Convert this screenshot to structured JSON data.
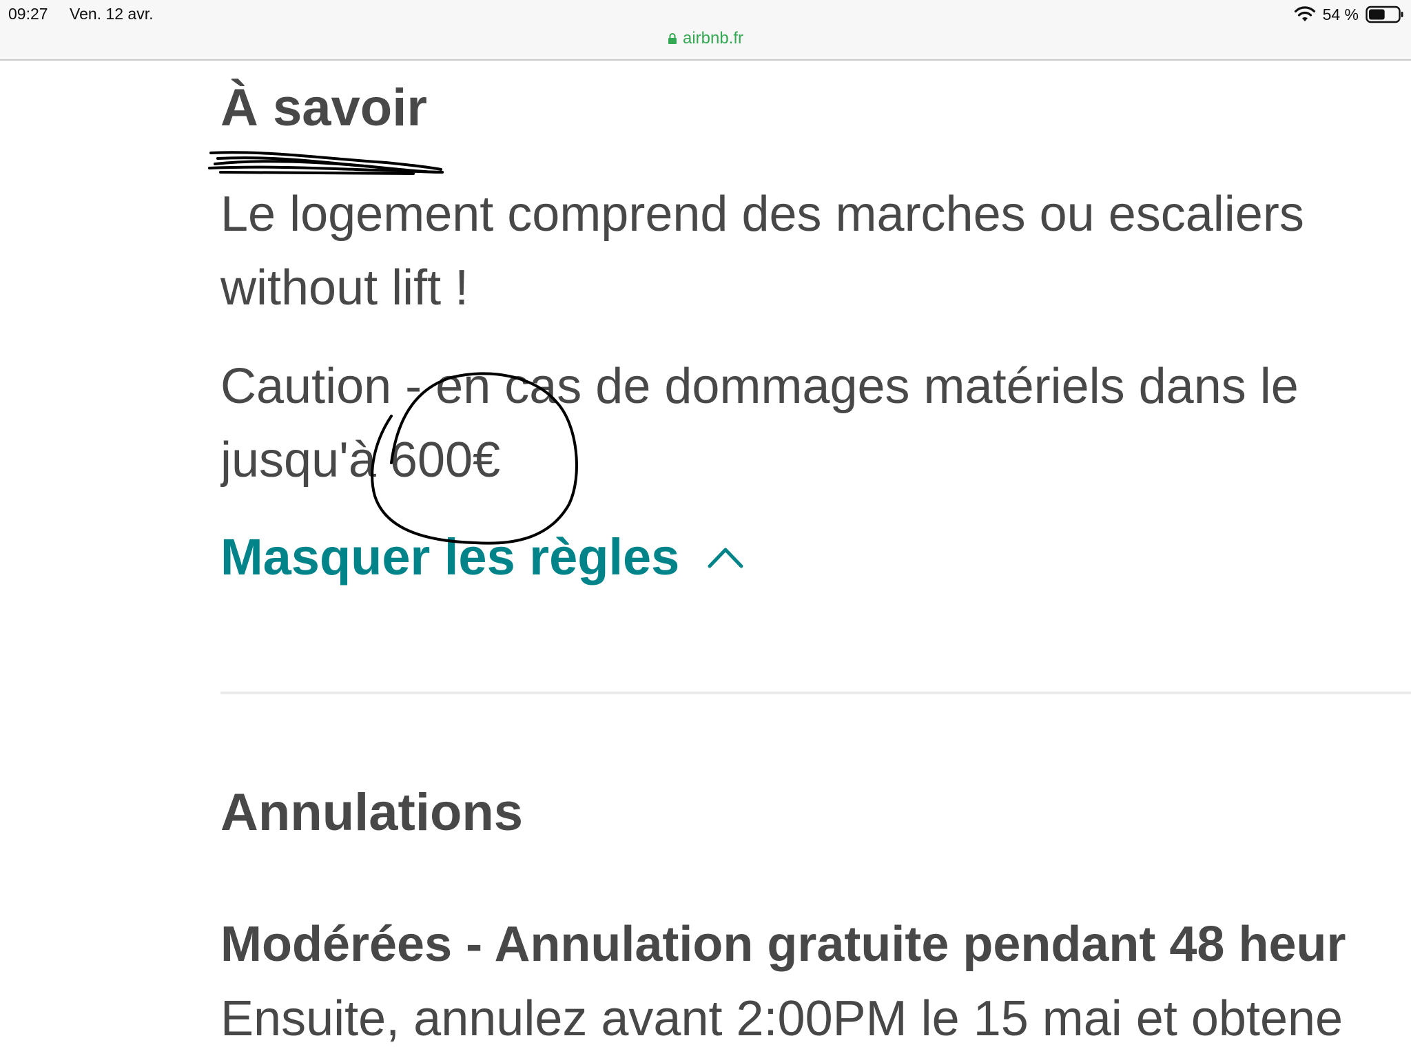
{
  "status_bar": {
    "time": "09:27",
    "date": "Ven. 12 avr.",
    "battery_percent": "54 %",
    "battery_level": 0.54,
    "icons": [
      "wifi-icon",
      "battery-icon"
    ]
  },
  "url_bar": {
    "url": "airbnb.fr",
    "icon": "lock-icon"
  },
  "things_to_know": {
    "title": "À savoir",
    "line_1": "Le logement comprend des marches ou escaliers",
    "line_2": "without lift !",
    "line_3": "Caution - en cas de dommages matériels dans le",
    "line_4": "jusqu'à 600€",
    "toggle_label": "Masquer les règles",
    "toggle_icon": "chevron-up-icon"
  },
  "cancellations": {
    "title": "Annulations",
    "policy_title": "Modérées - Annulation gratuite pendant 48 heur",
    "policy_text": "Ensuite, annulez avant 2:00PM le 15 mai et obtene"
  },
  "colors": {
    "text": "#484848",
    "link": "#008489",
    "url": "#34a853",
    "divider": "#ebebeb",
    "annotation": "#000000"
  }
}
